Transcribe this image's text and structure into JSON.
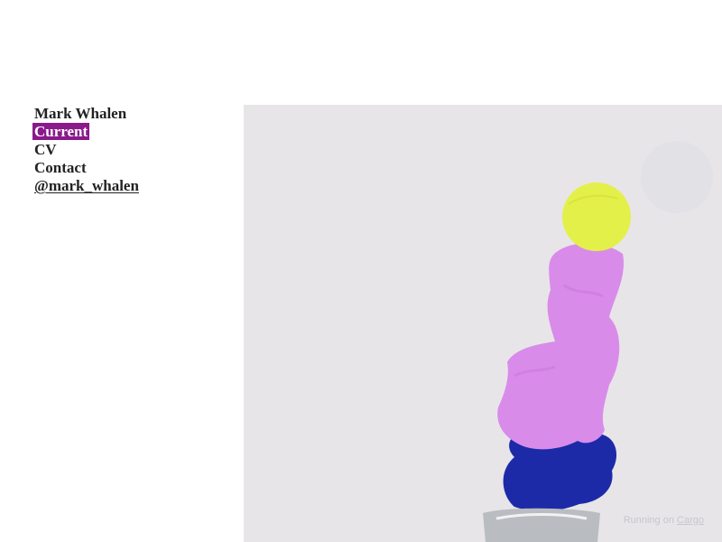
{
  "site": {
    "title": "Mark Whalen"
  },
  "nav": {
    "items": [
      {
        "label": "Current",
        "active": true
      },
      {
        "label": "CV",
        "active": false
      },
      {
        "label": "Contact",
        "active": false
      },
      {
        "label": "@mark_whalen",
        "active": false
      }
    ]
  },
  "hero": {
    "background_color": "#e7e5e8",
    "ball_color": "#e4f04a",
    "pink_form_color": "#d98bea",
    "blue_form_color": "#1c2aa8",
    "base_color": "#b9bcc1"
  },
  "footer": {
    "prefix": "Running on",
    "link_label": "Cargo"
  },
  "colors": {
    "accent": "#8a1a8c",
    "text": "#222222"
  }
}
